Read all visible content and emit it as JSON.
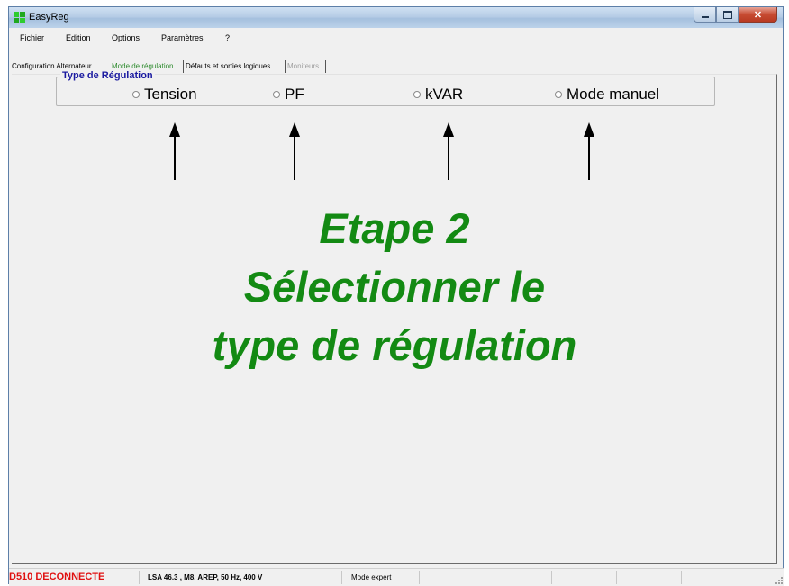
{
  "window": {
    "title": "EasyReg",
    "icon": "easyreg-app-icon"
  },
  "menu": [
    "Fichier",
    "Edition",
    "Options",
    "Paramètres",
    "?"
  ],
  "tabs": [
    {
      "label": "Configuration Alternateur",
      "state": "normal"
    },
    {
      "label": "Mode de régulation",
      "state": "active"
    },
    {
      "label": "Défauts et sorties logiques",
      "state": "normal"
    },
    {
      "label": "Moniteurs",
      "state": "disabled"
    }
  ],
  "regulation": {
    "group_title": "Type de Régulation",
    "options": [
      "Tension",
      "PF",
      "kVAR",
      "Mode manuel"
    ],
    "selected": null
  },
  "overlay": {
    "line1": "Etape 2",
    "line2": "Sélectionner le",
    "line3": "type de régulation",
    "color": "#138a13"
  },
  "status": {
    "connection": "D510 DECONNECTE",
    "machine": "LSA 46.3  , M8, AREP, 50 Hz, 400 V",
    "mode": "Mode expert"
  },
  "colors": {
    "group_title": "#1a1aa0",
    "status_error": "#e01010",
    "active_tab": "#2e8b2e"
  }
}
